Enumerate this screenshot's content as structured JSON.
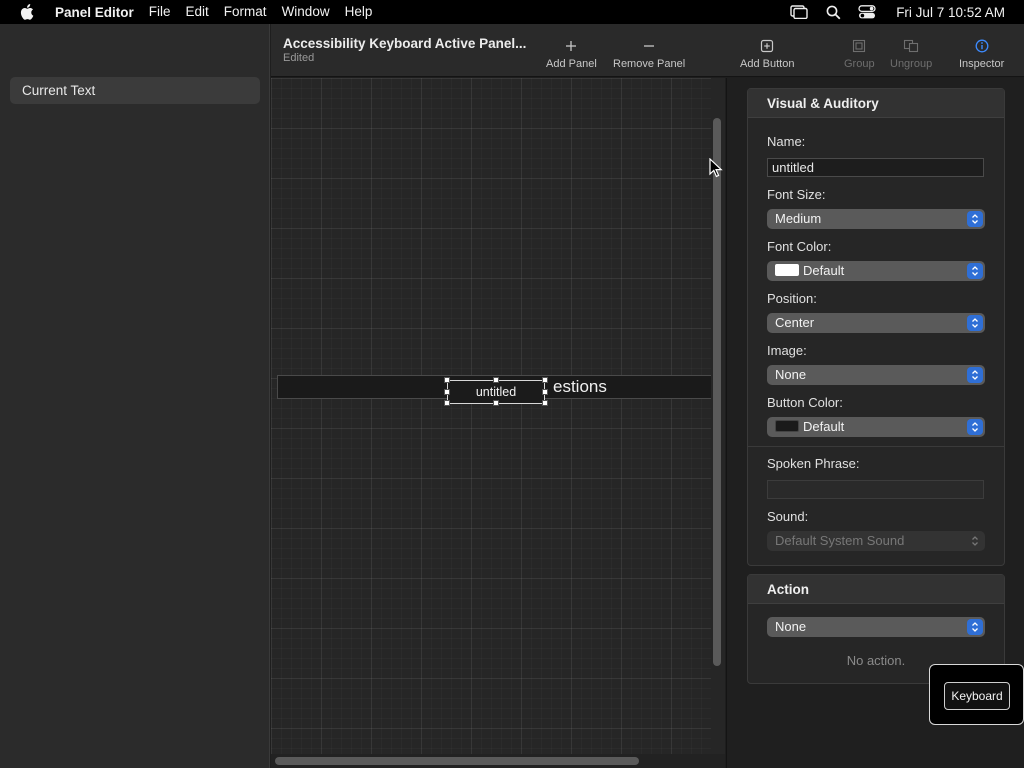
{
  "menubar": {
    "app_name": "Panel Editor",
    "menus": [
      "File",
      "Edit",
      "Format",
      "Window",
      "Help"
    ],
    "clock": "Fri Jul 7  10:52 AM",
    "status_icons": [
      "display-icon",
      "search-icon",
      "control-center-icon"
    ]
  },
  "sidebar": {
    "items": [
      {
        "label": "Current Text",
        "selected": true
      }
    ]
  },
  "toolbar": {
    "title": "Accessibility Keyboard Active Panel...",
    "subtitle": "Edited",
    "add_panel": "Add Panel",
    "remove_panel": "Remove Panel",
    "add_button": "Add Button",
    "group": "Group",
    "ungroup": "Ungroup",
    "inspector": "Inspector"
  },
  "canvas": {
    "panel_title_fragment": "estions",
    "selected_button_label": "untitled"
  },
  "inspector": {
    "section_title": "Visual & Auditory",
    "name_label": "Name:",
    "name_value": "untitled",
    "font_size_label": "Font Size:",
    "font_size_value": "Medium",
    "font_color_label": "Font Color:",
    "font_color_value": "Default",
    "font_color_swatch": "#ffffff",
    "position_label": "Position:",
    "position_value": "Center",
    "image_label": "Image:",
    "image_value": "None",
    "button_color_label": "Button Color:",
    "button_color_value": "Default",
    "button_color_swatch": "#1a1a1a",
    "spoken_phrase_label": "Spoken Phrase:",
    "spoken_phrase_value": "",
    "sound_label": "Sound:",
    "sound_value": "Default System Sound",
    "action_title": "Action",
    "action_value": "None",
    "action_note": "No action."
  },
  "floating": {
    "keyboard_button": "Keyboard"
  },
  "colors": {
    "accent": "#2f6fd6",
    "popup_bg": "#5a5a5a"
  }
}
